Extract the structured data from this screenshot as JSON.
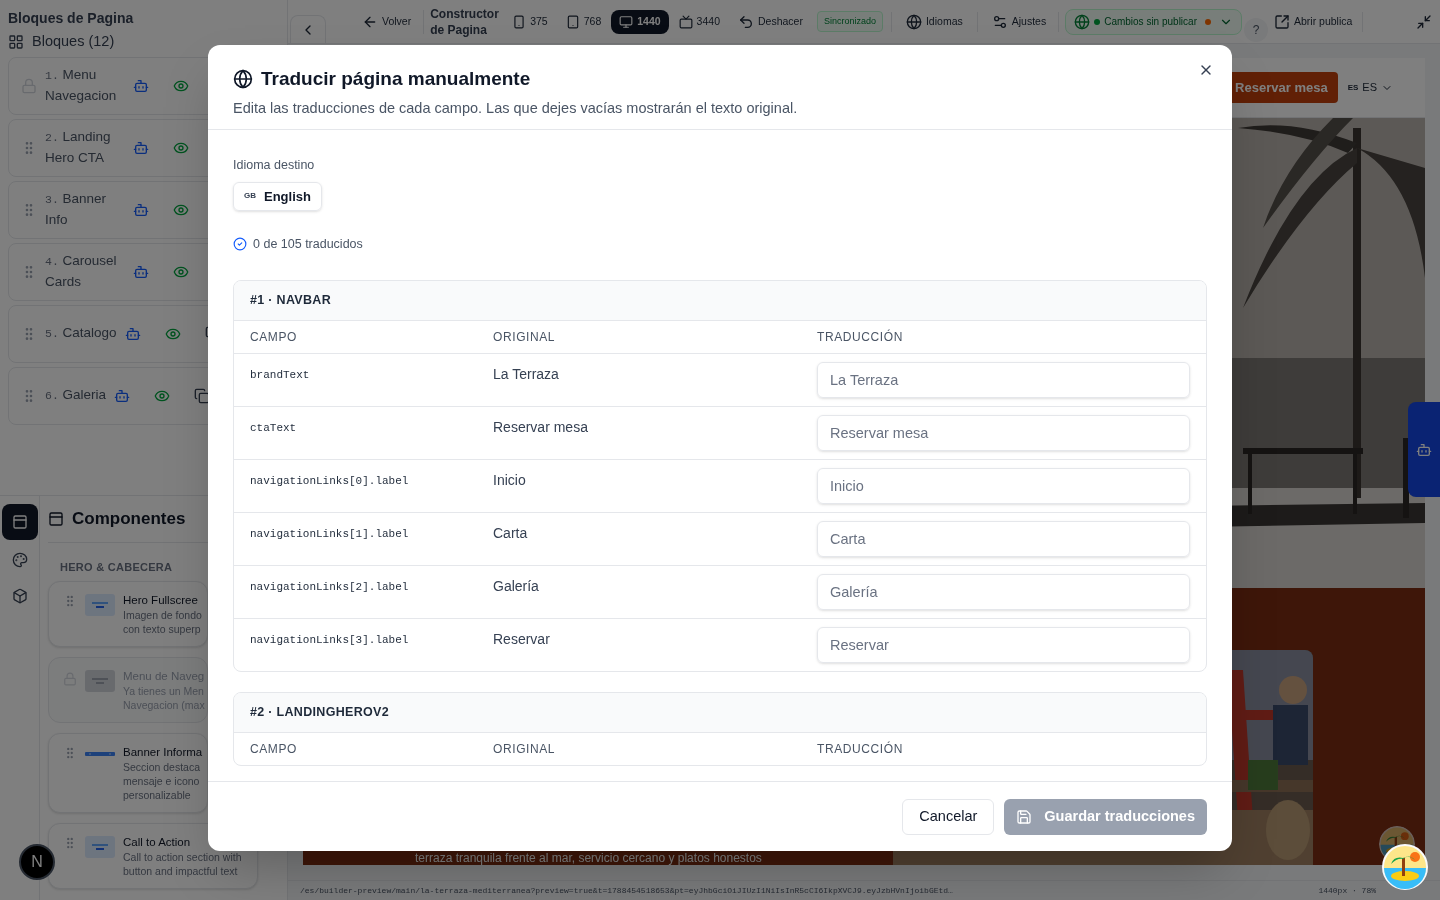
{
  "sidebar": {
    "title": "Bloques de Pagina",
    "blocks_label": "Bloques (12)",
    "blocks": [
      {
        "number": "1.",
        "name": "Menu Navegacion",
        "locked": true
      },
      {
        "number": "2.",
        "name": "Landing Hero CTA",
        "locked": false
      },
      {
        "number": "3.",
        "name": "Banner Info",
        "locked": false
      },
      {
        "number": "4.",
        "name": "Carousel Cards",
        "locked": false
      },
      {
        "number": "5.",
        "name": "Catalogo",
        "locked": false
      },
      {
        "number": "6.",
        "name": "Galeria",
        "locked": false
      }
    ],
    "rail": [
      {
        "kind": "components",
        "selected": true
      },
      {
        "kind": "theme",
        "selected": false
      },
      {
        "kind": "assets",
        "selected": false
      }
    ],
    "components_title": "Componentes",
    "category": "HERO & CABECERA",
    "components": [
      {
        "kind": "hero",
        "title": "Hero Fullscree",
        "lines": [
          "Imagen de fondo",
          "con texto superp"
        ],
        "disabled": false
      },
      {
        "kind": "menu",
        "title": "Menu de Naveg",
        "lines": [
          "Ya tienes un Men",
          "Navegacion (max"
        ],
        "disabled": true
      },
      {
        "kind": "banner",
        "title": "Banner Informa",
        "lines": [
          "Seccion destaca",
          "mensaje e icono",
          "personalizable"
        ],
        "disabled": false
      },
      {
        "kind": "hero",
        "title": "Call to Action",
        "lines": [
          "Call to action section with",
          "button and impactful text"
        ],
        "disabled": false
      }
    ],
    "dev_badge": "N"
  },
  "topbar": {
    "back": "Volver",
    "title": "Constructor de Pagina",
    "viewports": [
      {
        "kind": "phone",
        "label": "375",
        "selected": false
      },
      {
        "kind": "tablet",
        "label": "768",
        "selected": false
      },
      {
        "kind": "desktop",
        "label": "1440",
        "selected": true
      },
      {
        "kind": "tv",
        "label": "3440",
        "selected": false
      }
    ],
    "undo": "Deshacer",
    "sync": "Sincronizado",
    "languages": "Idiomas",
    "settings": "Ajustes",
    "publish_status": "Cambios sin publicar",
    "help": "?",
    "open_public": "Abrir publica"
  },
  "preview": {
    "cta": "Reservar mesa",
    "lang_code": "ES",
    "lang": "ES",
    "tagline": "terraza tranquila frente al mar, servicio cercano y platos honestos"
  },
  "status_bar": {
    "url": "/es/builder-preview/main/la-terraza-mediterranea?preview=true&t=1788454518653&pt=eyJhbGciOiJIUzI1NiIsInR5cCI6IkpXVCJ9.eyJzbHVnIjoibGEtd…",
    "zoom": "1440px · 78%"
  },
  "modal": {
    "title": "Traducir página manualmente",
    "subtitle": "Edita las traducciones de cada campo. Las que dejes vacías mostrarán el texto original.",
    "target_label": "Idioma destino",
    "language": {
      "code": "GB",
      "name": "English"
    },
    "progress": "0 de 105 traducidos",
    "sections": [
      {
        "heading": "#1 · NAVBAR",
        "columns": [
          "CAMPO",
          "ORIGINAL",
          "TRADUCCIÓN"
        ],
        "rows": [
          {
            "field": "brandText",
            "original": "La Terraza",
            "placeholder": "La Terraza"
          },
          {
            "field": "ctaText",
            "original": "Reservar mesa",
            "placeholder": "Reservar mesa"
          },
          {
            "field": "navigationLinks[0].label",
            "original": "Inicio",
            "placeholder": "Inicio"
          },
          {
            "field": "navigationLinks[1].label",
            "original": "Carta",
            "placeholder": "Carta"
          },
          {
            "field": "navigationLinks[2].label",
            "original": "Galería",
            "placeholder": "Galería"
          },
          {
            "field": "navigationLinks[3].label",
            "original": "Reservar",
            "placeholder": "Reservar"
          }
        ]
      },
      {
        "heading": "#2 · LANDINGHEROV2",
        "columns": [
          "CAMPO",
          "ORIGINAL",
          "TRADUCCIÓN"
        ]
      }
    ],
    "cancel": "Cancelar",
    "save": {
      "label": "Guardar traducciones",
      "disabled": true
    }
  }
}
